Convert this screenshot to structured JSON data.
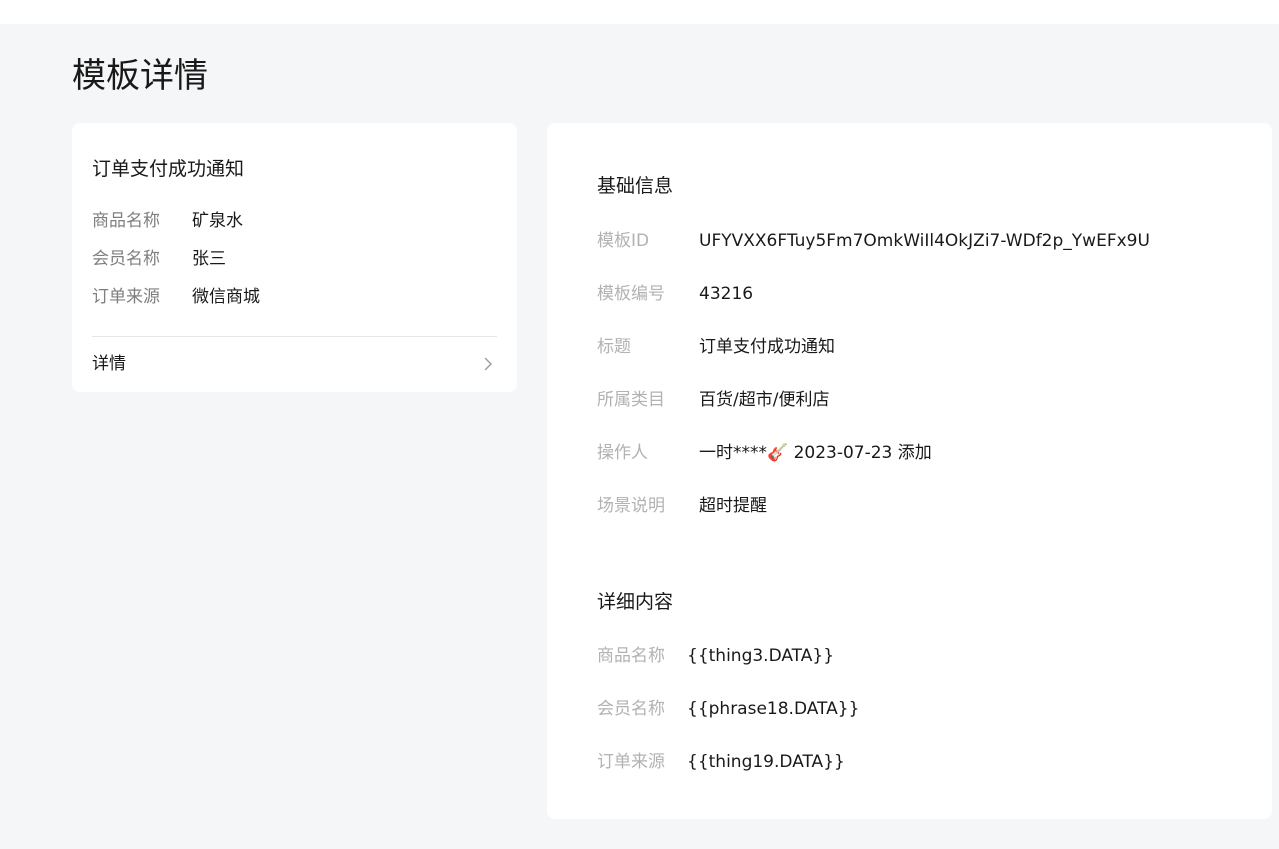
{
  "page": {
    "title": "模板详情"
  },
  "preview": {
    "title": "订单支付成功通知",
    "rows": [
      {
        "key": "商品名称",
        "value": "矿泉水"
      },
      {
        "key": "会员名称",
        "value": "张三"
      },
      {
        "key": "订单来源",
        "value": "微信商城"
      }
    ],
    "detail_label": "详情"
  },
  "basic": {
    "title": "基础信息",
    "rows": [
      {
        "key": "模板ID",
        "value": "UFYVXX6FTuy5Fm7OmkWiIl4OkJZi7-WDf2p_YwEFx9U"
      },
      {
        "key": "模板编号",
        "value": "43216"
      },
      {
        "key": "标题",
        "value": "订单支付成功通知"
      },
      {
        "key": "所属类目",
        "value": "百货/超市/便利店"
      },
      {
        "key": "操作人",
        "value": "一时****🎸 2023-07-23 添加"
      },
      {
        "key": "场景说明",
        "value": "超时提醒"
      }
    ]
  },
  "content": {
    "title": "详细内容",
    "rows": [
      {
        "key": "商品名称",
        "value": "{{thing3.DATA}}"
      },
      {
        "key": "会员名称",
        "value": "{{phrase18.DATA}}"
      },
      {
        "key": "订单来源",
        "value": "{{thing19.DATA}}"
      }
    ]
  },
  "icons": {
    "detail_arrow": "chevron-right-icon"
  }
}
